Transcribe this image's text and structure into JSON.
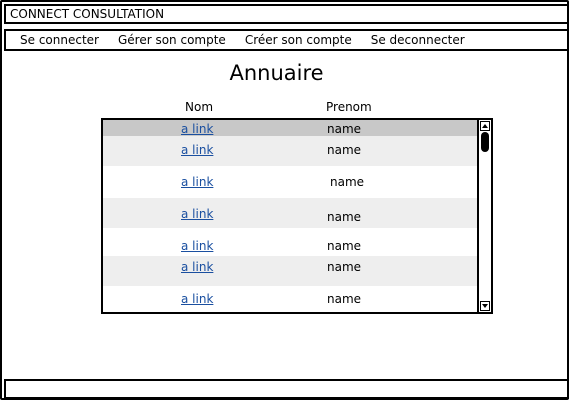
{
  "app": {
    "title": "CONNECT CONSULTATION"
  },
  "menu": {
    "items": [
      {
        "label": "Se connecter"
      },
      {
        "label": "Gérer son compte"
      },
      {
        "label": "Créer son compte"
      },
      {
        "label": "Se deconnecter"
      }
    ]
  },
  "page": {
    "title": "Annuaire"
  },
  "table": {
    "headers": {
      "nom": "Nom",
      "prenom": "Prenom"
    },
    "rows": [
      {
        "link": "a link",
        "name": "name",
        "selected": true
      },
      {
        "link": "a link",
        "name": "name"
      },
      {
        "link": "a link",
        "name": "name"
      },
      {
        "link": "a link",
        "name": "name"
      },
      {
        "link": "a link",
        "name": "name"
      },
      {
        "link": "a link",
        "name": "name"
      },
      {
        "link": "a link",
        "name": "name"
      }
    ]
  },
  "colors": {
    "selected_row": "#c8c8c8",
    "alt_row": "#eeeeee",
    "link": "#1a4fa0"
  }
}
